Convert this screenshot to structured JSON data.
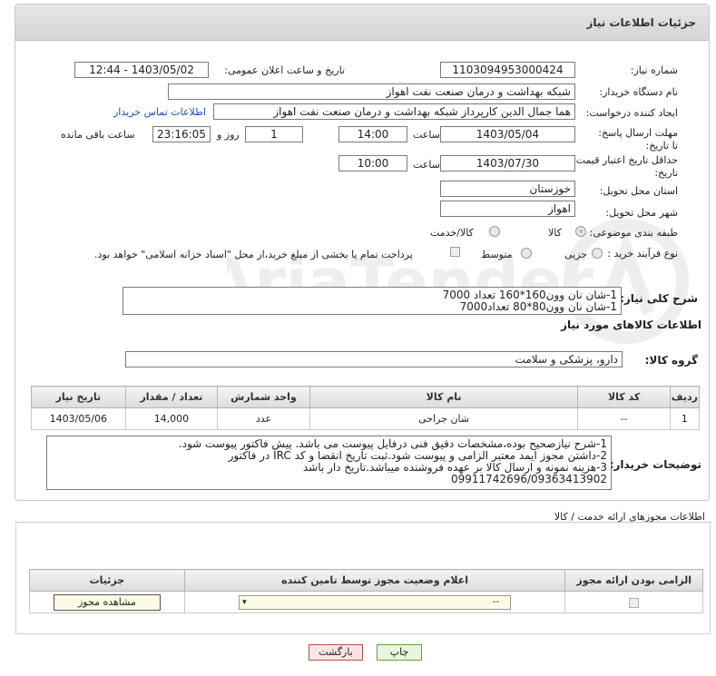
{
  "panel": {
    "title": "جزئیات اطلاعات نیاز"
  },
  "fields": {
    "need_number_label": "شماره نیاز:",
    "need_number": "1103094953000424",
    "announce_label": "تاریخ و ساعت اعلان عمومی:",
    "announce_value": "1403/05/02 - 12:44",
    "buyer_org_label": "نام دستگاه خریدار:",
    "buyer_org": "شبکه بهداشت و درمان صنعت نفت اهواز",
    "creator_label": "ایجاد کننده درخواست:",
    "creator": "هما جمال الدین کارپرداز شبکه بهداشت و درمان صنعت نفت اهواز",
    "contact_link": "اطلاعات تماس خریدار",
    "deadline_label": "مهلت ارسال پاسخ: تا تاریخ:",
    "deadline_date": "1403/05/04",
    "time_label": "ساعت",
    "deadline_time": "14:00",
    "days_value": "1",
    "days_label": "روز و",
    "remaining_time": "23:16:05",
    "remaining_label": "ساعت باقی مانده",
    "validity_label": "حداقل تاریخ اعتبار قیمت: تا تاریخ:",
    "validity_date": "1403/07/30",
    "validity_time": "10:00",
    "province_label": "استان محل تحویل:",
    "province": "خوزستان",
    "city_label": "شهر محل تحویل:",
    "city": "اهواز",
    "category_label": "طبقه بندی موضوعی:",
    "category_options": [
      "کالا",
      "کالا/خدمت"
    ],
    "process_label": "نوع فرآیند خرید :",
    "process_options": [
      "جزیی",
      "متوسط"
    ],
    "payment_note": "پرداخت تمام یا بخشی از مبلغ خرید،از محل \"اسناد خزانه اسلامی\" خواهد بود."
  },
  "summary": {
    "label": "شرح کلی نیاز:",
    "lines": [
      "1-شان نان وون160*160    تعداد 7000",
      "1-شان نان وون80*80    تعداد7000"
    ]
  },
  "goods": {
    "section_title": "اطلاعات کالاهای مورد نیاز",
    "group_label": "گروه کالا:",
    "group_value": "دارو، پزشکی و سلامت",
    "headers": [
      "ردیف",
      "کد کالا",
      "نام کالا",
      "واحد شمارش",
      "تعداد / مقدار",
      "تاریخ نیاز"
    ],
    "rows": [
      {
        "row": "1",
        "code": "--",
        "name": "شان جراحی",
        "unit": "عدد",
        "qty": "14,000",
        "date": "1403/05/06"
      }
    ]
  },
  "buyer_notes": {
    "label": "توضیحات خریدار:",
    "lines": [
      "1-شرح نیازصحیح بوده،مشخصات دقیق فنی درفایل پیوست می باشد. پیش فاکتور پیوست شود.",
      "2-داشتن مجوز ایمد معتبر الزامی و پیوست شود.ثبت تاریخ انقضا و کد IRC در فاکتور",
      "3-هزینه  نمونه و ارسال کالا بر عهده فروشنده میباشد.تاریخ دار باشد",
      "09911742696/09363413902"
    ]
  },
  "permits": {
    "section_title": "اطلاعات مجوزهای ارائه خدمت / کالا",
    "headers": [
      "الزامی بودن ارائه مجوز",
      "اعلام وضعیت مجوز توسط تامین کننده",
      "جزئیات"
    ],
    "select_value": "--",
    "view_button": "مشاهده مجوز"
  },
  "actions": {
    "print": "چاپ",
    "back": "بازگشت"
  }
}
